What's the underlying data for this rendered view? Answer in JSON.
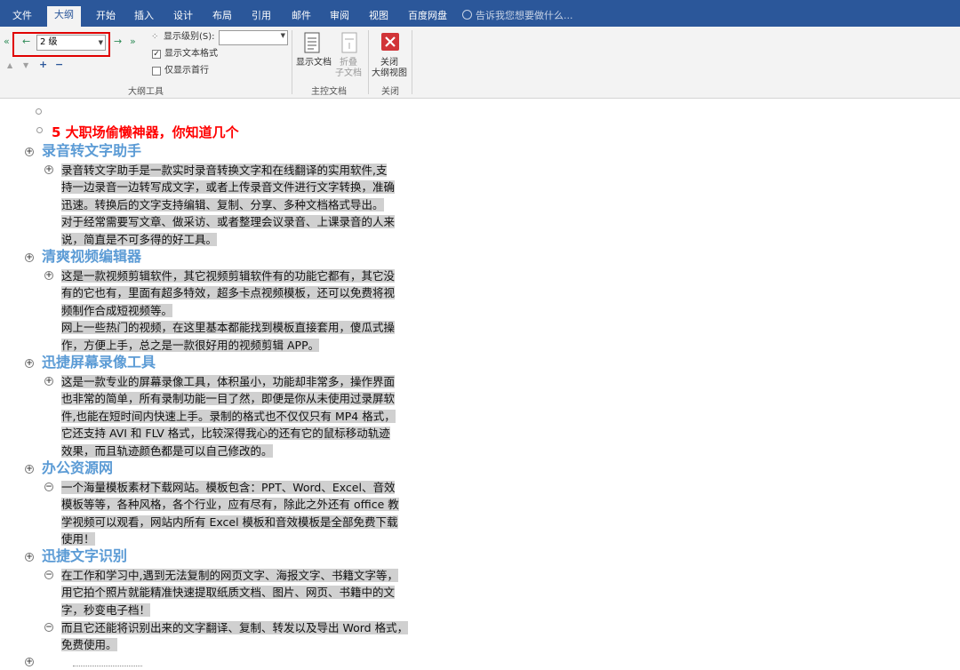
{
  "tabs": [
    "文件",
    "大纲",
    "开始",
    "插入",
    "设计",
    "布局",
    "引用",
    "邮件",
    "审阅",
    "视图",
    "百度网盘"
  ],
  "active_tab": "大纲",
  "tell_me": "告诉我您想要做什么...",
  "ribbon": {
    "level_value": "2 级",
    "show_level_label": "显示级别(S):",
    "show_text_format_label": "显示文本格式",
    "show_text_format_checked": true,
    "show_first_line_label": "仅显示首行",
    "show_first_line_checked": false,
    "outline_tools_label": "大纲工具",
    "show_document_label": "显示文档",
    "collapse_label_1": "折叠",
    "collapse_label_2": "子文档",
    "master_doc_label": "主控文档",
    "close_label_1": "关闭",
    "close_label_2": "大纲视图",
    "close_group_label": "关闭"
  },
  "document": {
    "title": "5 大职场偷懒神器，你知道几个",
    "sections": [
      {
        "heading": "录音转文字助手",
        "paras": [
          {
            "marker": "plus",
            "lines": [
              "录音转文字助手是一款实时录音转换文字和在线翻译的实用软件,支",
              "持一边录音一边转写成文字，或者上传录音文件进行文字转换，准确",
              "迅速。转换后的文字支持编辑、复制、分享、多种文档格式导出。",
              "对于经常需要写文章、做采访、或者整理会议录音、上课录音的人来",
              "说，简直是不可多得的好工具。"
            ]
          }
        ]
      },
      {
        "heading": "清爽视频编辑器",
        "paras": [
          {
            "marker": "plus",
            "lines": [
              "这是一款视频剪辑软件，其它视频剪辑软件有的功能它都有，其它没",
              "有的它也有，里面有超多特效，超多卡点视频模板，还可以免费将视",
              "频制作合成短视频等。",
              "网上一些热门的视频，在这里基本都能找到模板直接套用，傻瓜式操",
              "作，方便上手，总之是一款很好用的视频剪辑 APP。"
            ]
          }
        ]
      },
      {
        "heading": "迅捷屏幕录像工具",
        "paras": [
          {
            "marker": "plus",
            "lines": [
              "这是一款专业的屏幕录像工具，体积虽小，功能却非常多，操作界面",
              "也非常的简单，所有录制功能一目了然，即便是你从未使用过录屏软",
              "件,也能在短时间内快速上手。录制的格式也不仅仅只有 MP4 格式，",
              "它还支持 AVI 和 FLV 格式，比较深得我心的还有它的鼠标移动轨迹",
              "效果，而且轨迹颜色都是可以自己修改的。"
            ]
          }
        ]
      },
      {
        "heading": "办公资源网",
        "paras": [
          {
            "marker": "minus",
            "lines": [
              "一个海量模板素材下载网站。模板包含：PPT、Word、Excel、音效",
              "模板等等，各种风格，各个行业，应有尽有，除此之外还有 office 教",
              "学视频可以观看，网站内所有 Excel 模板和音效模板是全部免费下载",
              "使用！"
            ]
          }
        ]
      },
      {
        "heading": "迅捷文字识别",
        "paras": [
          {
            "marker": "minus",
            "lines": [
              "在工作和学习中,遇到无法复制的网页文字、海报文字、书籍文字等，",
              "用它拍个照片就能精准快速提取纸质文档、图片、网页、书籍中的文",
              "字，秒变电子档！"
            ]
          },
          {
            "marker": "minus",
            "lines": [
              "而且它还能将识别出来的文字翻译、复制、转发以及导出 Word 格式，",
              "免费使用。"
            ]
          }
        ]
      }
    ]
  }
}
